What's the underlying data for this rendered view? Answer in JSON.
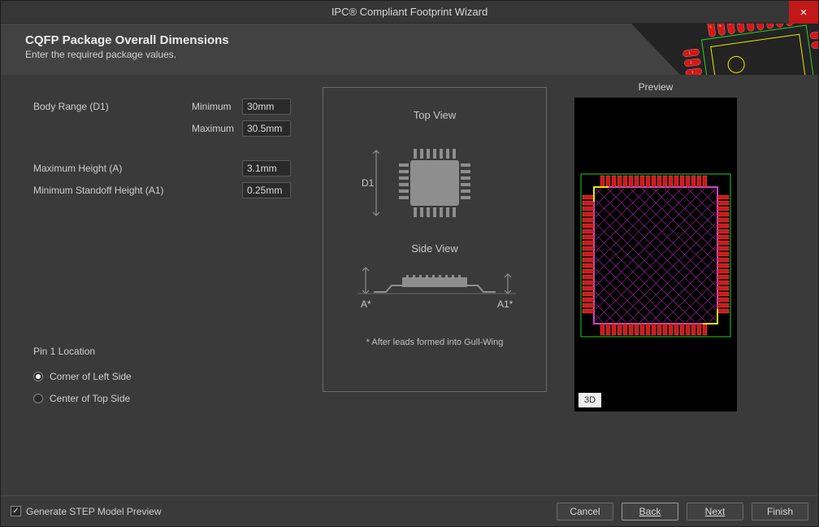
{
  "window": {
    "title": "IPC® Compliant Footprint Wizard",
    "close_label": "×"
  },
  "banner": {
    "title": "CQFP Package Overall Dimensions",
    "subtitle": "Enter the required package values."
  },
  "fields": {
    "body_range": {
      "label": "Body Range (D1)",
      "min_label": "Minimum",
      "min_value": "30mm",
      "max_label": "Maximum",
      "max_value": "30.5mm"
    },
    "max_height": {
      "label": "Maximum Height (A)",
      "value": "3.1mm"
    },
    "min_standoff": {
      "label": "Minimum Standoff Height (A1)",
      "value": "0.25mm"
    }
  },
  "pin1": {
    "heading": "Pin 1 Location",
    "option1": "Corner of Left Side",
    "option2": "Center of Top Side",
    "selected": 0
  },
  "diagram": {
    "top_view_label": "Top View",
    "side_view_label": "Side View",
    "d1_label": "D1",
    "a_label": "A*",
    "a1_label": "A1*",
    "footnote": "* After leads formed into Gull-Wing"
  },
  "preview": {
    "label": "Preview",
    "button_3d": "3D"
  },
  "footer": {
    "step_checkbox": "Generate STEP Model Preview",
    "step_checked": true,
    "cancel": "Cancel",
    "back": "Back",
    "next": "Next",
    "finish": "Finish"
  }
}
